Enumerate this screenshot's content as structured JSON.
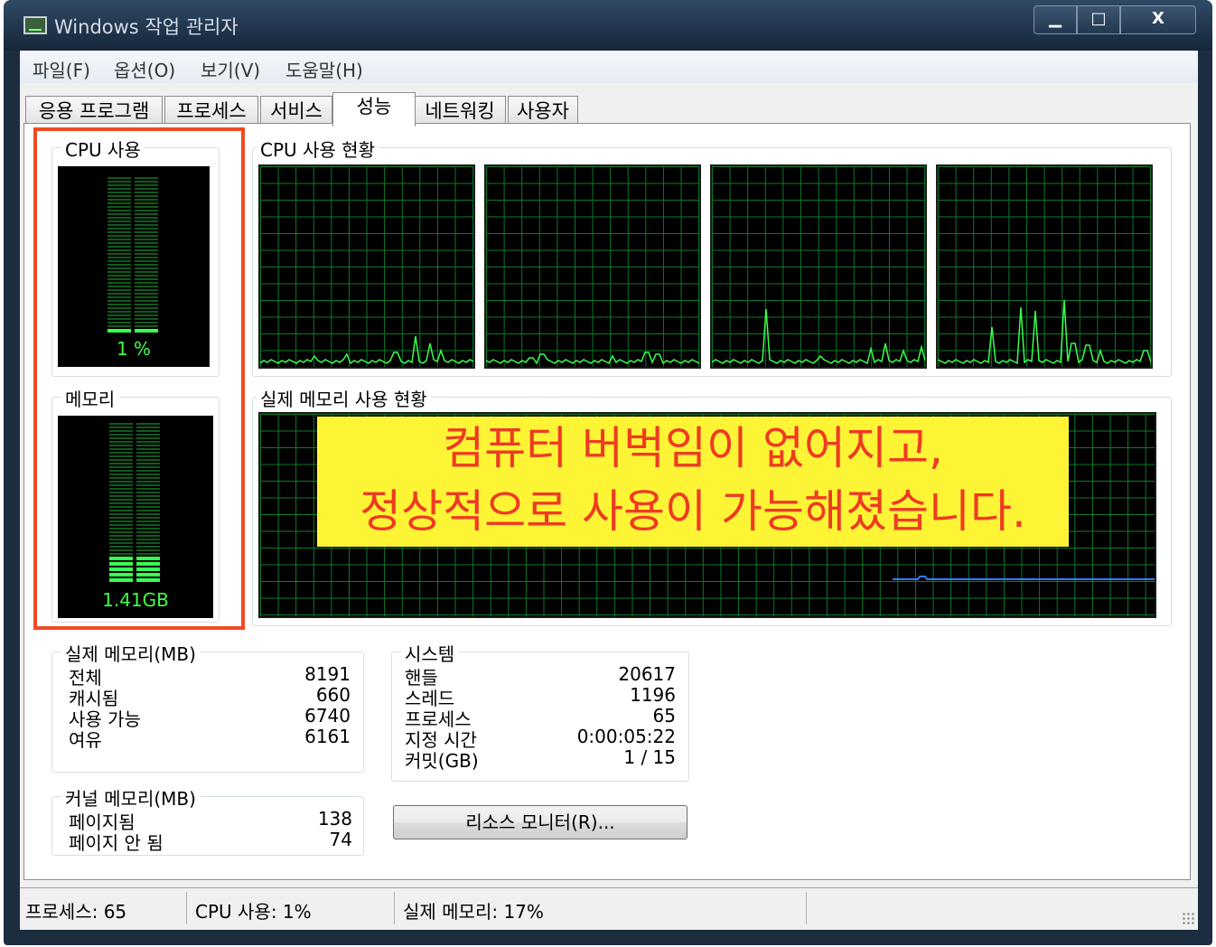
{
  "window": {
    "title": "Windows 작업 관리자",
    "controls": {
      "minimize": "▁",
      "maximize": "□",
      "close": "X"
    }
  },
  "menu": [
    "파일(F)",
    "옵션(O)",
    "보기(V)",
    "도움말(H)"
  ],
  "tabs": [
    {
      "label": "응용 프로그램",
      "active": false
    },
    {
      "label": "프로세스",
      "active": false
    },
    {
      "label": "서비스",
      "active": false
    },
    {
      "label": "성능",
      "active": true
    },
    {
      "label": "네트워킹",
      "active": false
    },
    {
      "label": "사용자",
      "active": false
    }
  ],
  "cpu_usage": {
    "label": "CPU 사용",
    "value": "1 %",
    "fraction": 0.01
  },
  "cpu_history": {
    "label": "CPU 사용 현황",
    "cores": 4
  },
  "memory": {
    "label": "메모리",
    "value": "1.41GB",
    "fraction": 0.17
  },
  "memory_history": {
    "label": "실제 메모리 사용 현황"
  },
  "physical_memory": {
    "label": "실제 메모리(MB)",
    "rows": [
      {
        "name": "전체",
        "value": "8191"
      },
      {
        "name": "캐시됨",
        "value": "660"
      },
      {
        "name": "사용 가능",
        "value": "6740"
      },
      {
        "name": "여유",
        "value": "6161"
      }
    ]
  },
  "kernel_memory": {
    "label": "커널 메모리(MB)",
    "rows": [
      {
        "name": "페이지됨",
        "value": "138"
      },
      {
        "name": "페이지 안 됨",
        "value": "74"
      }
    ]
  },
  "system": {
    "label": "시스템",
    "rows": [
      {
        "name": "핸들",
        "value": "20617"
      },
      {
        "name": "스레드",
        "value": "1196"
      },
      {
        "name": "프로세스",
        "value": "65"
      },
      {
        "name": "지정 시간",
        "value": "0:00:05:22"
      },
      {
        "name": "커밋(GB)",
        "value": "1 / 15"
      }
    ]
  },
  "resource_monitor_button": "리소스 모니터(R)...",
  "status_bar": {
    "processes": "프로세스: 65",
    "cpu": "CPU 사용: 1%",
    "memory": "실제 메모리: 17%"
  },
  "annotation": {
    "line1": "컴퓨터 버벅임이 없어지고,",
    "line2": "정상적으로 사용이 가능해졌습니다.",
    "box_color": "#f04a24",
    "background": "#fef436",
    "text_color": "#ef3b22"
  },
  "colors": {
    "graph_line": "#3cff4c",
    "graph_grid": "#0b7a2c",
    "memory_line": "#2e7bff"
  }
}
